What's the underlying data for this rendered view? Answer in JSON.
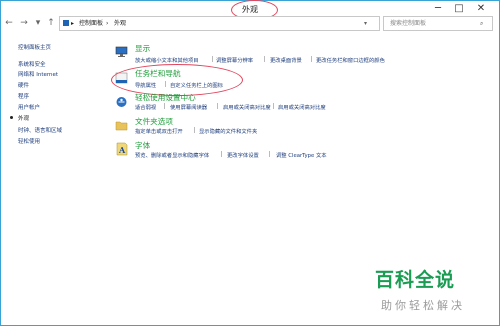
{
  "window": {
    "title": "外观"
  },
  "titlebar_buttons": {
    "minimize": "─",
    "maximize": "□",
    "close": "✕"
  },
  "nav": {
    "back": "←",
    "forward": "→",
    "dropdown": "▾",
    "up": "↑"
  },
  "address": {
    "root": "▸",
    "path1": "控制面板",
    "path2": "外观",
    "chev": "›"
  },
  "search": {
    "placeholder": "搜索控制面板",
    "icon": "⌕"
  },
  "sidebar": {
    "items": [
      {
        "label": "控制面板主页"
      },
      {
        "label": "系统和安全"
      },
      {
        "label": "网络和 Internet"
      },
      {
        "label": "硬件"
      },
      {
        "label": "程序"
      },
      {
        "label": "用户帐户"
      },
      {
        "label": "外观"
      },
      {
        "label": "时钟、语言和区域"
      },
      {
        "label": "轻松使用"
      }
    ]
  },
  "categories": [
    {
      "title": "显示",
      "links": [
        "放大或缩小文本和其他项目",
        "调整屏幕分辨率",
        "更改桌面背景",
        "更改任务栏和窗口边框的颜色"
      ]
    },
    {
      "title": "任务栏和导航",
      "links": [
        "导航属性",
        "自定义任务栏上的图标"
      ]
    },
    {
      "title": "轻松使用设置中心",
      "links": [
        "适合弱视",
        "使用屏幕阅读器",
        "启用或关闭高对比度",
        "启用或关闭高对比度"
      ]
    },
    {
      "title": "文件夹选项",
      "links": [
        "指定单击或双击打开",
        "显示隐藏的文件和文件夹"
      ]
    },
    {
      "title": "字体",
      "links": [
        "预览、删除或者显示和隐藏字体",
        "更改字体设置",
        "调整 ClearType 文本"
      ]
    }
  ],
  "watermark": {
    "line1": "百科全说",
    "line2": "助你轻松解决"
  },
  "colors": {
    "accent": "#3aa3d6",
    "category": "#1e9e3a",
    "link": "#1c3c7c",
    "annotation": "#e0455b"
  }
}
